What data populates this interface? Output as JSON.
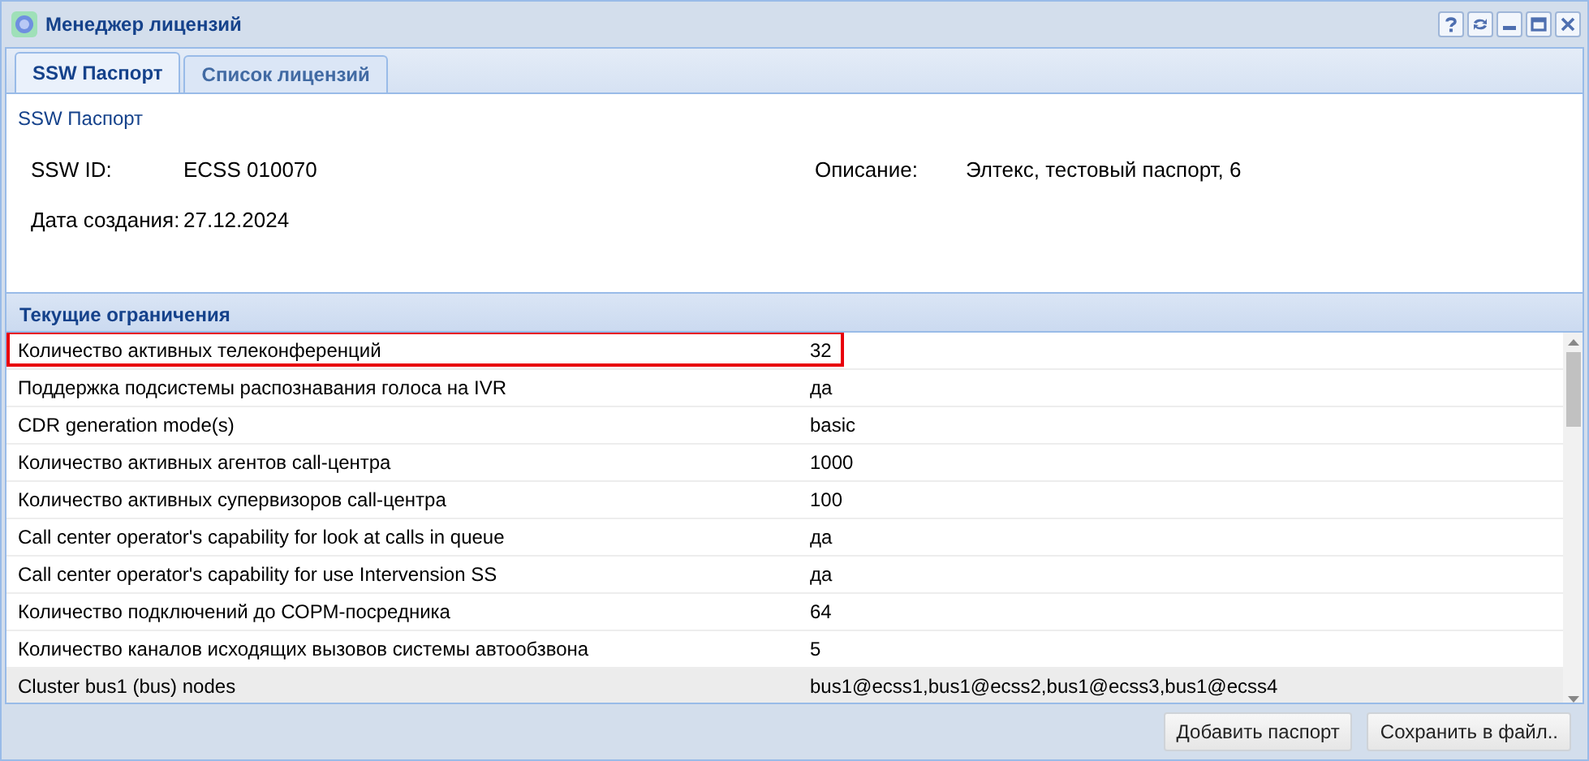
{
  "window": {
    "title": "Менеджер лицензий"
  },
  "tabs": [
    {
      "label": "SSW Паспорт",
      "selected": true
    },
    {
      "label": "Список лицензий",
      "selected": false
    }
  ],
  "passport": {
    "heading": "SSW Паспорт",
    "fields": [
      {
        "label": "SSW ID:",
        "value": "ECSS 010070"
      },
      {
        "label": "Описание:",
        "value": "Элтекс, тестовый паспорт, 6"
      },
      {
        "label": "Дата создания:",
        "value": "27.12.2024"
      }
    ]
  },
  "limits": {
    "title": "Текущие ограничения",
    "rows": [
      {
        "name": "Количество активных телеконференций",
        "value": "32",
        "highlighted": true,
        "selected": false
      },
      {
        "name": "Поддержка подсистемы распознавания голоса на IVR",
        "value": "да",
        "highlighted": false,
        "selected": false
      },
      {
        "name": "CDR generation mode(s)",
        "value": "basic",
        "highlighted": false,
        "selected": false
      },
      {
        "name": "Количество активных агентов call-центра",
        "value": "1000",
        "highlighted": false,
        "selected": false
      },
      {
        "name": "Количество активных супервизоров call-центра",
        "value": "100",
        "highlighted": false,
        "selected": false
      },
      {
        "name": "Call center operator's capability for look at calls in queue",
        "value": "да",
        "highlighted": false,
        "selected": false
      },
      {
        "name": "Call center operator's capability for use Intervension SS",
        "value": "да",
        "highlighted": false,
        "selected": false
      },
      {
        "name": "Количество подключений до СОРМ-посредника",
        "value": "64",
        "highlighted": false,
        "selected": false
      },
      {
        "name": "Количество каналов исходящих вызовов системы автообзвона",
        "value": "5",
        "highlighted": false,
        "selected": false
      },
      {
        "name": "Cluster bus1 (bus) nodes",
        "value": "bus1@ecss1,bus1@ecss2,bus1@ecss3,bus1@ecss4",
        "highlighted": false,
        "selected": true
      }
    ]
  },
  "buttons": [
    "Добавить паспорт",
    "Сохранить в файл.."
  ]
}
